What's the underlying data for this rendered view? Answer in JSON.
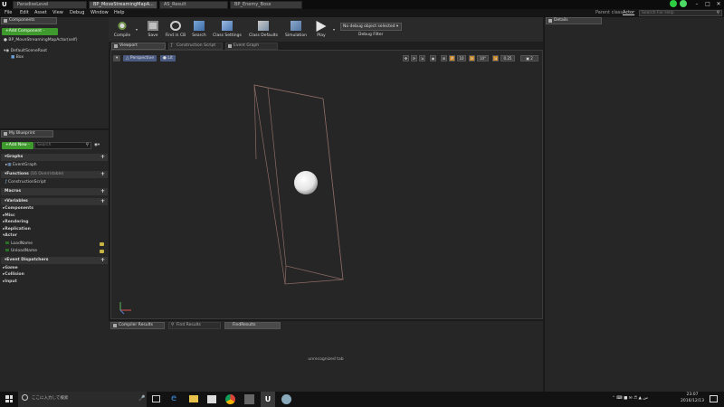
{
  "doc_tabs": [
    "ParadiseLevel",
    "BP_MoveStreamingMapA...",
    "AS_Result",
    "BP_Enemy_Boss"
  ],
  "menu": [
    "File",
    "Edit",
    "Asset",
    "View",
    "Debug",
    "Window",
    "Help"
  ],
  "parent_class": {
    "label": "Parent class:",
    "value": "Actor"
  },
  "search_help_placeholder": "Search For Help",
  "toolbar": [
    {
      "label": "Compile",
      "icon": "compile-icon"
    },
    {
      "label": "Save",
      "icon": "save-icon"
    },
    {
      "label": "Find in CB",
      "icon": "find-in-cb-icon"
    },
    {
      "label": "Search",
      "icon": "search-icon"
    },
    {
      "label": "Class Settings",
      "icon": "class-settings-icon"
    },
    {
      "label": "Class Defaults",
      "icon": "class-defaults-icon"
    },
    {
      "label": "Simulation",
      "icon": "simulation-icon"
    },
    {
      "label": "Play",
      "icon": "play-icon"
    }
  ],
  "debug": {
    "selected": "No debug object selected ▾",
    "label": "Debug Filter"
  },
  "components": {
    "tab": "Components",
    "add_button": "+Add Component -",
    "self": "BP_MoveStreamingMapActor(self)",
    "root": "DefaultSceneRoot",
    "child": "Box"
  },
  "my_blueprint": {
    "tab": "My Blueprint",
    "add_new": "+Add New -",
    "search_placeholder": "Search",
    "graphs": "Graphs",
    "event_graph": "EventGraph",
    "functions": "Functions",
    "functions_note": "(16 Overridable)",
    "construction_script": "ConstructionScript",
    "macros": "Macros",
    "variables": "Variables",
    "var_groups": [
      "Components",
      "Misc",
      "Rendering",
      "Replication",
      "Actor"
    ],
    "vars": [
      "LoadName",
      "UnloadName"
    ],
    "event_dispatchers": "Event Dispatchers",
    "ed_groups": [
      "Game",
      "Collision",
      "Input"
    ]
  },
  "editor_tabs": [
    "Viewport",
    "Construction Script",
    "Event Graph"
  ],
  "viewport": {
    "perspective": "Perspective",
    "lit": "Lit",
    "grid_snap": "10",
    "rot_snap": "10°",
    "scale_snap": "0.25",
    "cam_speed": "2"
  },
  "bottom_tabs": [
    "Compiler Results",
    "Find Results",
    "FindResults"
  ],
  "bottom_message": "unrecognized tab",
  "details_tab": "Details",
  "taskbar": {
    "search_placeholder": "ここに入力して検索",
    "time": "23:07",
    "date": "2016/12/13"
  }
}
